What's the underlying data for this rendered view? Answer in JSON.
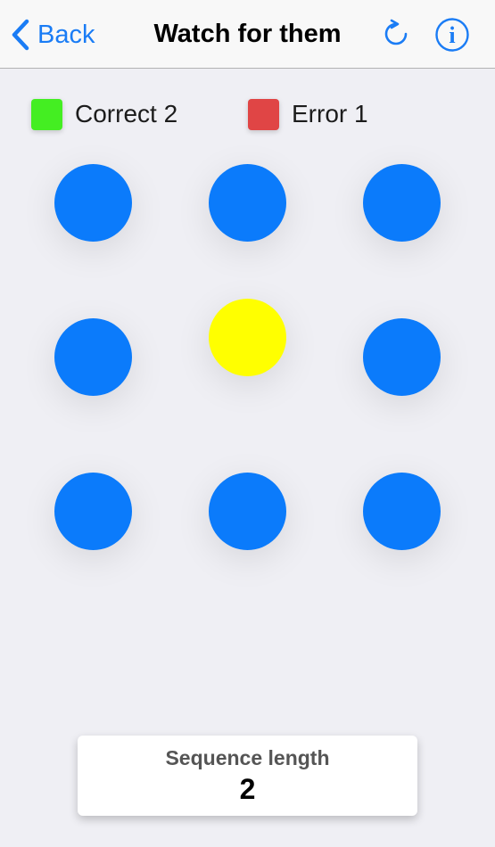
{
  "navbar": {
    "back_label": "Back",
    "title": "Watch for them",
    "accent": "#1a7cf5",
    "icons": [
      "chevron-left-icon",
      "restart-icon",
      "info-icon"
    ]
  },
  "legend": {
    "correct": {
      "label": "Correct 2",
      "color": "#44ee22"
    },
    "error": {
      "label": "Error 1",
      "color": "#e04545"
    }
  },
  "board": {
    "rows": 3,
    "cols": 3,
    "dots": [
      {
        "state": "idle",
        "color": "#0b7bfb"
      },
      {
        "state": "idle",
        "color": "#0b7bfb"
      },
      {
        "state": "idle",
        "color": "#0b7bfb"
      },
      {
        "state": "idle",
        "color": "#0b7bfb"
      },
      {
        "state": "lit",
        "color": "#ffff00"
      },
      {
        "state": "idle",
        "color": "#0b7bfb"
      },
      {
        "state": "idle",
        "color": "#0b7bfb"
      },
      {
        "state": "idle",
        "color": "#0b7bfb"
      },
      {
        "state": "idle",
        "color": "#0b7bfb"
      }
    ]
  },
  "sequence": {
    "label": "Sequence length",
    "value": "2"
  }
}
